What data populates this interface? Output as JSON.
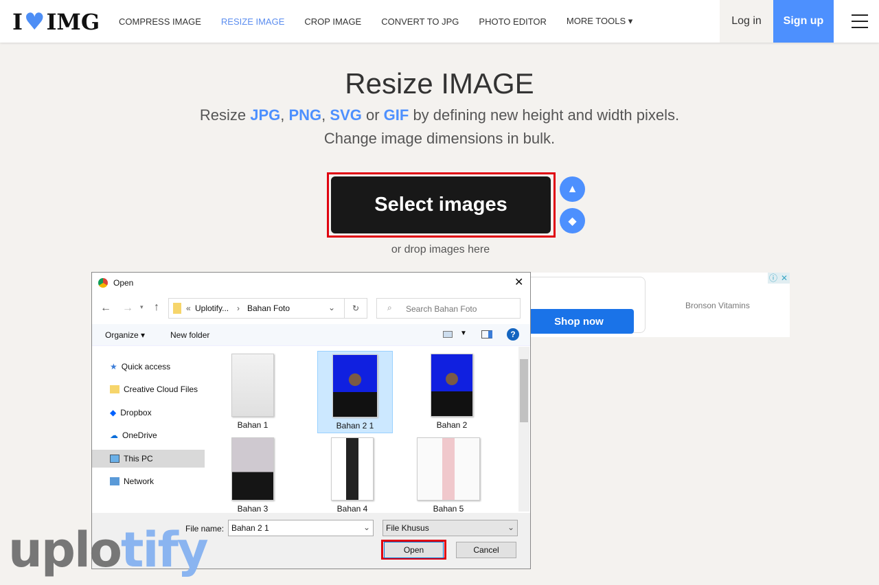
{
  "nav": {
    "logo": "I ❤ IMG",
    "logo_left": "I",
    "logo_right": "IMG",
    "items": [
      "COMPRESS IMAGE",
      "RESIZE IMAGE",
      "CROP IMAGE",
      "CONVERT TO JPG",
      "PHOTO EDITOR",
      "MORE TOOLS ▾"
    ],
    "active": "RESIZE IMAGE",
    "login": "Log in",
    "signup": "Sign up"
  },
  "hero": {
    "title": "Resize IMAGE",
    "sub1_pre": "Resize ",
    "jpg": "JPG",
    "c1": ", ",
    "png": "PNG",
    "c2": ", ",
    "svg": "SVG",
    "or": " or ",
    "gif": "GIF",
    "sub1_post": " by defining new height and width pixels.",
    "sub2": "Change image dimensions in bulk.",
    "select": "Select images",
    "drop": "or drop images here"
  },
  "ad": {
    "shop": "Shop now",
    "brand": "Bronson Vitamins"
  },
  "dialog": {
    "title": "Open",
    "path_prefix": "«",
    "path1": "Uplotify...",
    "sep": "›",
    "path2": "Bahan Foto",
    "search_placeholder": "Search Bahan Foto",
    "organize": "Organize ▾",
    "new_folder": "New folder",
    "nav_items": [
      "Quick access",
      "Creative Cloud Files",
      "Dropbox",
      "OneDrive",
      "This PC",
      "Network"
    ],
    "selected_nav": "This PC",
    "files": [
      "Bahan 1",
      "Bahan 2 1",
      "Bahan 2",
      "Bahan 3",
      "Bahan 4",
      "Bahan 5"
    ],
    "selected_file": "Bahan 2 1",
    "filename_label": "File name:",
    "filename": "Bahan 2 1",
    "filetype": "File Khusus",
    "open": "Open",
    "cancel": "Cancel"
  },
  "watermark": {
    "a": "uplo",
    "b": "tify"
  },
  "colors": {
    "accent": "#4d90fe",
    "highlight": "#e0000f"
  }
}
